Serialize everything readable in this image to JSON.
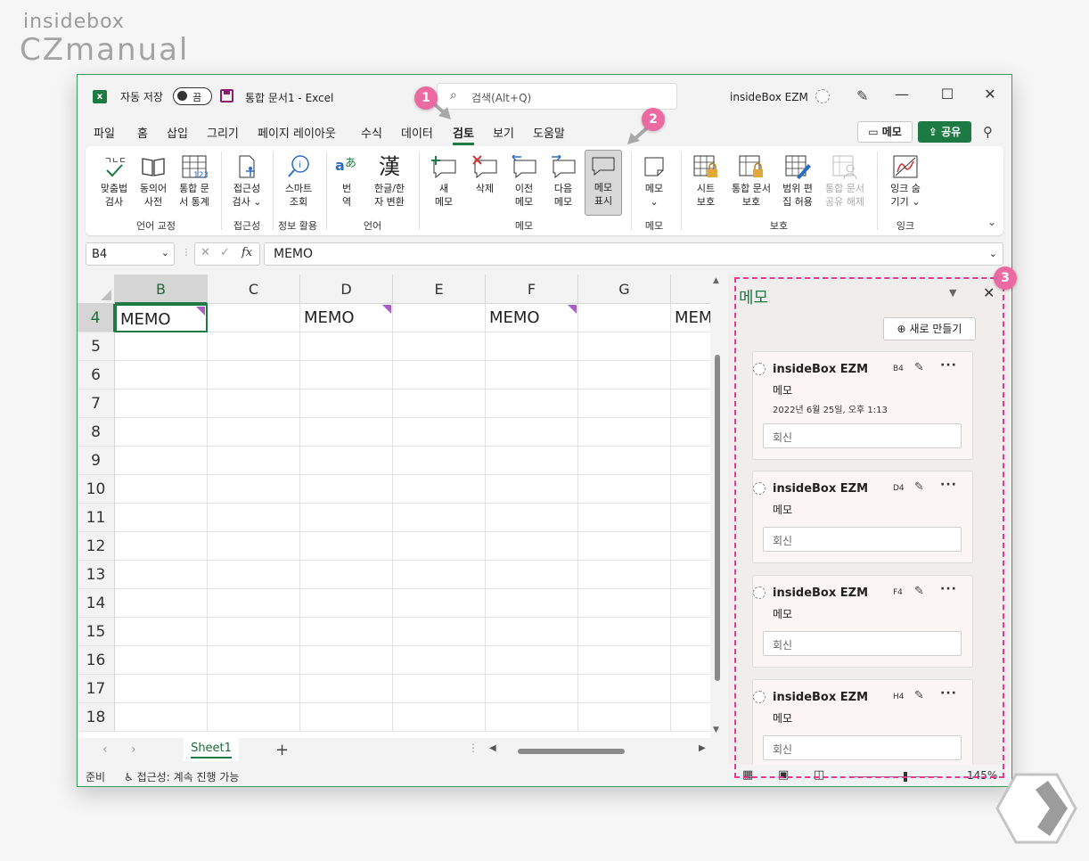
{
  "watermark": {
    "line1": "insidebox",
    "line2": "CZmanual"
  },
  "titlebar": {
    "autosave_label": "자동 저장",
    "toggle_state": "끔",
    "doc_title": "통합 문서1  -  Excel",
    "search_placeholder": "검색(Alt+Q)",
    "user_name": "insideBox EZM",
    "minimize": "—",
    "maximize": "☐",
    "close": "✕"
  },
  "tabs": [
    {
      "label": "파일"
    },
    {
      "label": "홈"
    },
    {
      "label": "삽입"
    },
    {
      "label": "그리기"
    },
    {
      "label": "페이지 레이아웃"
    },
    {
      "label": "수식"
    },
    {
      "label": "데이터"
    },
    {
      "label": "검토"
    },
    {
      "label": "보기"
    },
    {
      "label": "도움말"
    }
  ],
  "header_buttons": {
    "memo": "메모",
    "share": "공유"
  },
  "ribbon": {
    "buttons": [
      {
        "l1": "맞춤법",
        "l2": "검사"
      },
      {
        "l1": "동의어",
        "l2": "사전"
      },
      {
        "l1": "통합 문",
        "l2": "서 통계"
      },
      {
        "l1": "접근성",
        "l2": "검사 ⌄"
      },
      {
        "l1": "스마트",
        "l2": "조회"
      },
      {
        "l1": "번",
        "l2": "역"
      },
      {
        "l1": "한글/한",
        "l2": "자 변환"
      },
      {
        "l1": "새",
        "l2": "메모"
      },
      {
        "l1": "삭제",
        "l2": ""
      },
      {
        "l1": "이전",
        "l2": "메모"
      },
      {
        "l1": "다음",
        "l2": "메모"
      },
      {
        "l1": "메모",
        "l2": "표시"
      },
      {
        "l1": "메모",
        "l2": "⌄"
      },
      {
        "l1": "시트",
        "l2": "보호"
      },
      {
        "l1": "통합 문서",
        "l2": "보호"
      },
      {
        "l1": "범위 편",
        "l2": "집 허용"
      },
      {
        "l1": "통합 문서",
        "l2": "공유 해제"
      },
      {
        "l1": "잉크 숨",
        "l2": "기기 ⌄"
      }
    ],
    "groups": [
      "언어 교정",
      "접근성",
      "정보 활용",
      "언어",
      "메모",
      "메모",
      "보호",
      "잉크"
    ],
    "han_glyph": "漢"
  },
  "formula_bar": {
    "name_box": "B4",
    "fx": "fx",
    "value": "MEMO"
  },
  "grid": {
    "columns": [
      "B",
      "C",
      "D",
      "E",
      "F",
      "G",
      ""
    ],
    "rows": [
      "4",
      "5",
      "6",
      "7",
      "8",
      "9",
      "10",
      "11",
      "12",
      "13",
      "14",
      "15",
      "16",
      "17",
      "18"
    ],
    "row4_cells": [
      "MEMO",
      "",
      "MEMO",
      "",
      "MEMO",
      "",
      "MEMO"
    ]
  },
  "sheets": {
    "tab": "Sheet1",
    "add": "+"
  },
  "status": {
    "ready": "준비",
    "accessibility": "접근성: 계속 진행 가능",
    "zoom": "145%"
  },
  "memo_pane": {
    "title": "메모",
    "new_button": "새로 만들기",
    "cards": [
      {
        "author": "insideBox EZM",
        "ref": "B4",
        "body": "메모",
        "time": "2022년 6월 25일, 오후 1:13",
        "reply": "회신"
      },
      {
        "author": "insideBox EZM",
        "ref": "D4",
        "body": "메모",
        "reply": "회신"
      },
      {
        "author": "insideBox EZM",
        "ref": "F4",
        "body": "메모",
        "reply": "회신"
      },
      {
        "author": "insideBox EZM",
        "ref": "H4",
        "body": "메모",
        "reply": "회신"
      }
    ]
  },
  "badges": [
    "1",
    "2",
    "3"
  ],
  "colors": {
    "excel_green": "#1d7a43",
    "memo_indicator": "#a85fc4",
    "badge_pink": "#ec6aa2",
    "highlight_dash": "#e23b8a"
  }
}
